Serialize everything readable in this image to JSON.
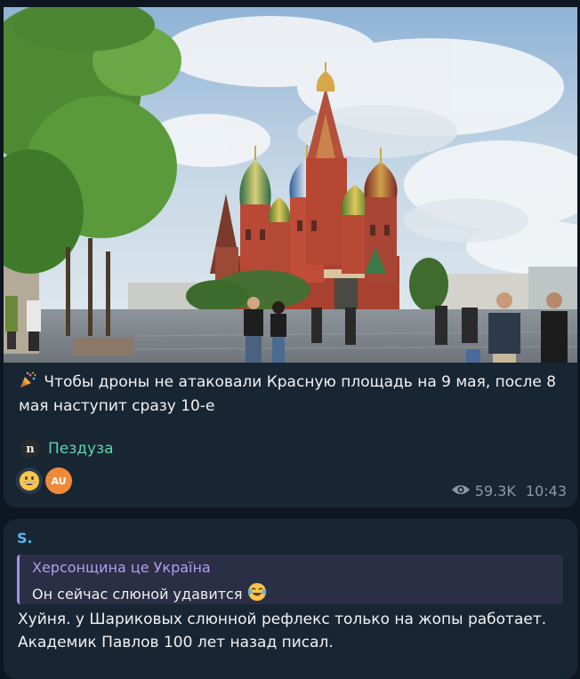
{
  "post": {
    "text": "Чтобы дроны не атаковали Красную площадь на 9 мая, после 8 мая наступит сразу 10-е",
    "leading_emoji": "party-popper-icon",
    "signature": {
      "avatar_letter": "n",
      "name": "Пездуза"
    },
    "reactions": [
      {
        "emoji": "grinning-face-icon"
      },
      {
        "label": "AU",
        "color": "#f08a3a"
      }
    ],
    "views": "59.3K",
    "time": "10:43"
  },
  "reply": {
    "author": "S.",
    "quote": {
      "author": "Херсонщина це Україна",
      "text": "Он сейчас слюной удавится",
      "emoji": "tears-of-joy-icon"
    },
    "text": "Хуйня. у Шариковых слюнной рефлекс только на жопы работает. Академик Павлов 100 лет назад писал."
  },
  "colors": {
    "background": "#0e1621",
    "bubble": "#182533",
    "signature": "#5fd4a9",
    "reply_author": "#5ab6e8",
    "quote_accent": "#b49df0",
    "meta": "#8a9aab"
  }
}
